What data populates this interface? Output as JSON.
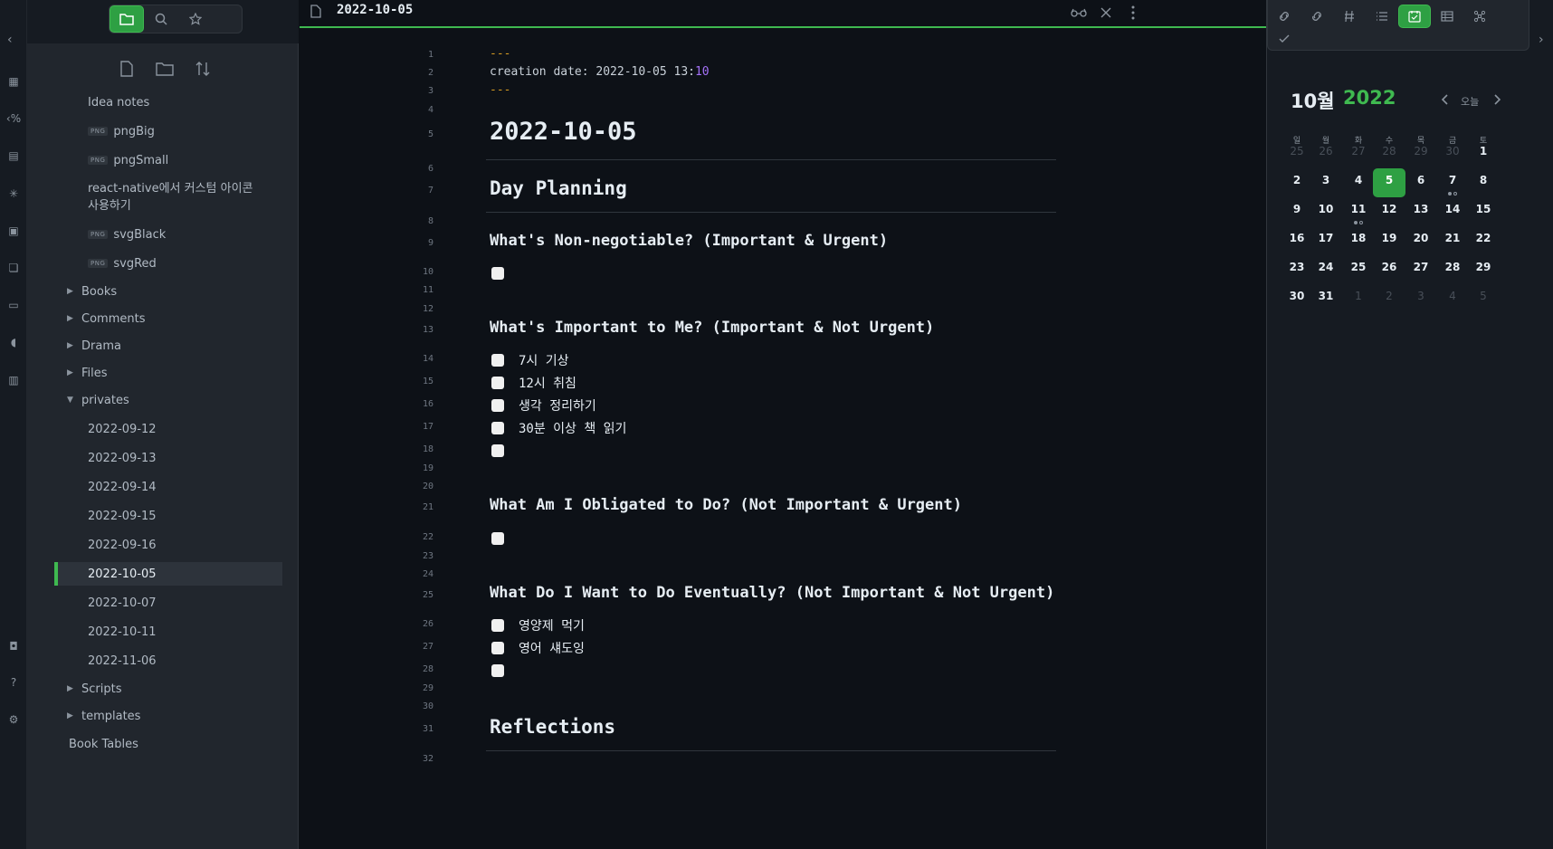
{
  "ribbon": {
    "icons": [
      "table-icon",
      "template-icon",
      "note-icon",
      "graph-icon",
      "calendar-icon",
      "copy-icon",
      "slides-icon",
      "mic-icon",
      "database-icon",
      "vault-icon",
      "help-icon",
      "settings-icon"
    ]
  },
  "left": {
    "tabs": [
      "files-tab",
      "search-tab",
      "bookmarks-tab"
    ],
    "tree": [
      {
        "label": "Idea notes",
        "type": "file"
      },
      {
        "label": "pngBig",
        "type": "png"
      },
      {
        "label": "pngSmall",
        "type": "png"
      },
      {
        "label": "react-native에서 커스텀 아이콘 사용하기",
        "type": "file"
      },
      {
        "label": "svgBlack",
        "type": "png"
      },
      {
        "label": "svgRed",
        "type": "png"
      },
      {
        "label": "Books",
        "type": "folder"
      },
      {
        "label": "Comments",
        "type": "folder"
      },
      {
        "label": "Drama",
        "type": "folder"
      },
      {
        "label": "Files",
        "type": "folder"
      },
      {
        "label": "privates",
        "type": "folder-open"
      },
      {
        "label": "2022-09-12",
        "type": "file"
      },
      {
        "label": "2022-09-13",
        "type": "file"
      },
      {
        "label": "2022-09-14",
        "type": "file"
      },
      {
        "label": "2022-09-15",
        "type": "file"
      },
      {
        "label": "2022-09-16",
        "type": "file"
      },
      {
        "label": "2022-10-05",
        "type": "active"
      },
      {
        "label": "2022-10-07",
        "type": "file"
      },
      {
        "label": "2022-10-11",
        "type": "file"
      },
      {
        "label": "2022-11-06",
        "type": "file"
      },
      {
        "label": "Scripts",
        "type": "folder"
      },
      {
        "label": "templates",
        "type": "folder"
      },
      {
        "label": "Book Tables",
        "type": "root-file"
      }
    ],
    "png_badge": "PNG"
  },
  "editor": {
    "title": "2022-10-05",
    "lines": [
      {
        "n": "1",
        "kind": "dash",
        "text": "---"
      },
      {
        "n": "2",
        "kind": "meta",
        "text": "creation date: 2022-10-05 13:",
        "accent": "10"
      },
      {
        "n": "3",
        "kind": "dash",
        "text": "---"
      },
      {
        "n": "4",
        "kind": "blank",
        "text": ""
      },
      {
        "n": "5",
        "kind": "h1",
        "text": "2022-10-05"
      },
      {
        "n": "6",
        "kind": "blank",
        "text": ""
      },
      {
        "n": "7",
        "kind": "h2",
        "text": "Day Planning"
      },
      {
        "n": "8",
        "kind": "blank",
        "text": ""
      },
      {
        "n": "9",
        "kind": "h3",
        "text": "What's Non-negotiable? (Important & Urgent)"
      },
      {
        "n": "10",
        "kind": "task",
        "text": ""
      },
      {
        "n": "11",
        "kind": "blank",
        "text": ""
      },
      {
        "n": "12",
        "kind": "blank",
        "text": ""
      },
      {
        "n": "13",
        "kind": "h3",
        "text": "What's Important to Me? (Important & Not Urgent)"
      },
      {
        "n": "14",
        "kind": "task",
        "text": "7시 기상"
      },
      {
        "n": "15",
        "kind": "task",
        "text": "12시 취침"
      },
      {
        "n": "16",
        "kind": "task",
        "text": "생각 정리하기"
      },
      {
        "n": "17",
        "kind": "task",
        "text": "30분 이상 책 읽기"
      },
      {
        "n": "18",
        "kind": "task",
        "text": ""
      },
      {
        "n": "19",
        "kind": "blank",
        "text": ""
      },
      {
        "n": "20",
        "kind": "blank",
        "text": ""
      },
      {
        "n": "21",
        "kind": "h3",
        "text": "What Am I Obligated to Do? (Not Important & Urgent)"
      },
      {
        "n": "22",
        "kind": "task",
        "text": ""
      },
      {
        "n": "23",
        "kind": "blank",
        "text": ""
      },
      {
        "n": "24",
        "kind": "blank",
        "text": ""
      },
      {
        "n": "25",
        "kind": "h3",
        "text": "What Do I Want to Do Eventually? (Not Important & Not Urgent)"
      },
      {
        "n": "26",
        "kind": "task",
        "text": "영양제 먹기"
      },
      {
        "n": "27",
        "kind": "task",
        "text": "영어 섀도잉"
      },
      {
        "n": "28",
        "kind": "task",
        "text": ""
      },
      {
        "n": "29",
        "kind": "blank",
        "text": ""
      },
      {
        "n": "30",
        "kind": "blank",
        "text": ""
      },
      {
        "n": "31",
        "kind": "h2",
        "text": "Reflections"
      },
      {
        "n": "32",
        "kind": "blank",
        "text": ""
      }
    ]
  },
  "calendar": {
    "month": "10월",
    "year": "2022",
    "today_label": "오늘",
    "weekdays": [
      "일",
      "월",
      "화",
      "수",
      "목",
      "금",
      "토"
    ],
    "weeks": [
      [
        "25",
        "26",
        "27",
        "28",
        "29",
        "30",
        "1"
      ],
      [
        "2",
        "3",
        "4",
        "5",
        "6",
        "7",
        "8"
      ],
      [
        "9",
        "10",
        "11",
        "12",
        "13",
        "14",
        "15"
      ],
      [
        "16",
        "17",
        "18",
        "19",
        "20",
        "21",
        "22"
      ],
      [
        "23",
        "24",
        "25",
        "26",
        "27",
        "28",
        "29"
      ],
      [
        "30",
        "31",
        "1",
        "2",
        "3",
        "4",
        "5"
      ]
    ],
    "today": "5",
    "dot_days": {
      "7": [
        "filled",
        "hollow"
      ],
      "11": [
        "filled",
        "hollow"
      ]
    }
  },
  "colors": {
    "accent": "#2ea043",
    "bg": "#0d1117",
    "panel": "#21262d",
    "yaml_dash": "#d29922",
    "meta_accent": "#a371f7"
  }
}
